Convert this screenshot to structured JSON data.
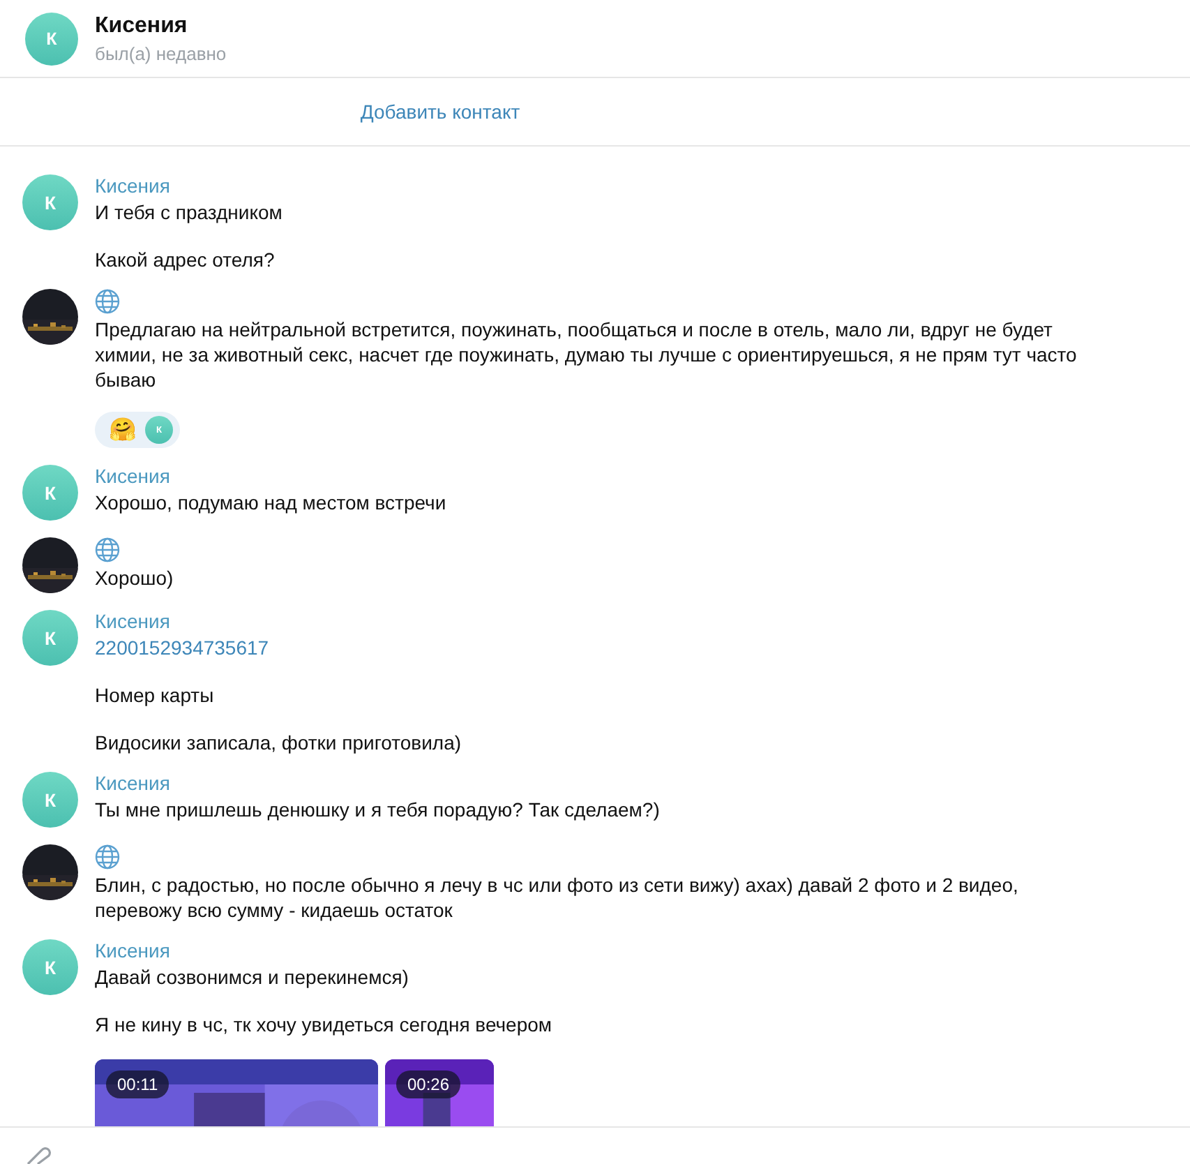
{
  "header": {
    "avatar_letter": "К",
    "name": "Кисения",
    "status": "был(а) недавно"
  },
  "add_contact": "Добавить контакт",
  "groups": [
    {
      "kind": "contact",
      "avatar_letter": "К",
      "name": "Кисения",
      "messages": [
        {
          "kind": "text",
          "text": "И тебя с праздником"
        },
        {
          "kind": "text",
          "text": "Какой адрес отеля?"
        }
      ]
    },
    {
      "kind": "self",
      "messages": [
        {
          "kind": "text",
          "text": "Предлагаю на нейтральной встретится, поужинать, пообщаться и после в отель, мало ли, вдруг не будет химии, не за животный секс, насчет где поужинать, думаю ты лучше с ориентируешься, я не прям тут часто бываю",
          "reaction": {
            "emoji": "🤗",
            "avatar_letter": "К"
          }
        }
      ]
    },
    {
      "kind": "contact",
      "avatar_letter": "К",
      "name": "Кисения",
      "messages": [
        {
          "kind": "text",
          "text": "Хорошо, подумаю над местом встречи"
        }
      ]
    },
    {
      "kind": "self",
      "messages": [
        {
          "kind": "text",
          "text": "Хорошо)"
        }
      ]
    },
    {
      "kind": "contact",
      "avatar_letter": "К",
      "name": "Кисения",
      "messages": [
        {
          "kind": "link",
          "text": "2200152934735617"
        },
        {
          "kind": "text",
          "text": "Номер карты"
        },
        {
          "kind": "text",
          "text": "Видосики записала, фотки приготовила)"
        }
      ]
    },
    {
      "kind": "contact",
      "avatar_letter": "К",
      "name": "Кисения",
      "messages": [
        {
          "kind": "text",
          "text": "Ты мне пришлешь денюшку и я  тебя порадую? Так сделаем?)"
        }
      ]
    },
    {
      "kind": "self",
      "messages": [
        {
          "kind": "text",
          "text": "Блин, с радостью,  но после обычно я лечу в чс или фото из сети вижу) ахах) давай 2 фото и 2 видео, перевожу всю сумму - кидаешь остаток"
        }
      ]
    },
    {
      "kind": "contact",
      "avatar_letter": "К",
      "name": "Кисения",
      "messages": [
        {
          "kind": "text",
          "text": "Давай созвонимся и перекинемся)"
        },
        {
          "kind": "text",
          "text": "Я не кину в чс, тк хочу увидеться сегодня вечером"
        },
        {
          "kind": "videos",
          "videos": [
            {
              "duration": "00:11",
              "wide": true
            },
            {
              "duration": "00:26",
              "wide": false
            }
          ]
        }
      ]
    }
  ]
}
